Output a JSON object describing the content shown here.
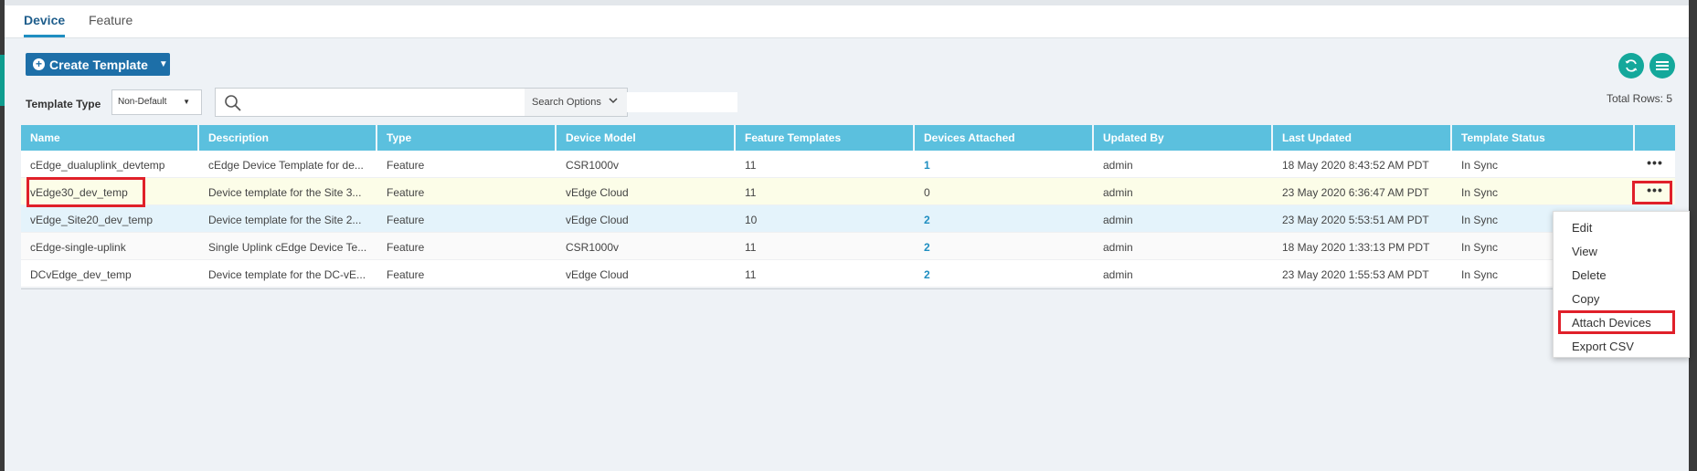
{
  "tabs": [
    {
      "label": "Device"
    },
    {
      "label": "Feature"
    }
  ],
  "toolbar": {
    "create_label": "Create Template",
    "template_type_label": "Template Type",
    "template_type_value": "Non-Default",
    "search_placeholder": "",
    "search_options_label": "Search Options",
    "total_rows": "Total Rows: 5"
  },
  "table": {
    "headers": [
      "Name",
      "Description",
      "Type",
      "Device Model",
      "Feature Templates",
      "Devices Attached",
      "Updated By",
      "Last Updated",
      "Template Status"
    ],
    "rows": [
      [
        "cEdge_dualuplink_devtemp",
        "cEdge Device Template for de...",
        "Feature",
        "CSR1000v",
        "11",
        "1",
        "admin",
        "18 May 2020 8:43:52 AM PDT",
        "In Sync"
      ],
      [
        "vEdge30_dev_temp",
        "Device template for the Site 3...",
        "Feature",
        "vEdge Cloud",
        "11",
        "0",
        "admin",
        "23 May 2020 6:36:47 AM PDT",
        "In Sync"
      ],
      [
        "vEdge_Site20_dev_temp",
        "Device template for the Site 2...",
        "Feature",
        "vEdge Cloud",
        "10",
        "2",
        "admin",
        "23 May 2020 5:53:51 AM PDT",
        "In Sync"
      ],
      [
        "cEdge-single-uplink",
        "Single Uplink cEdge Device Te...",
        "Feature",
        "CSR1000v",
        "11",
        "2",
        "admin",
        "18 May 2020 1:33:13 PM PDT",
        "In Sync"
      ],
      [
        "DCvEdge_dev_temp",
        "Device template for the DC-vE...",
        "Feature",
        "vEdge Cloud",
        "11",
        "2",
        "admin",
        "23 May 2020 1:55:53 AM PDT",
        "In Sync"
      ]
    ],
    "more_label": "•••"
  },
  "context_menu": {
    "items": [
      "Edit",
      "View",
      "Delete",
      "Copy",
      "Attach Devices",
      "Export CSV"
    ]
  },
  "colors": {
    "header": "#5bc0de",
    "primary_button": "#1d6fa8",
    "round_button": "#14a89b",
    "highlight": "#e0202a"
  },
  "icons": [
    "plus-circle-icon",
    "caret-down-icon",
    "refresh-icon",
    "list-menu-icon",
    "search-icon",
    "chevron-down-icon",
    "more-dots-icon"
  ]
}
